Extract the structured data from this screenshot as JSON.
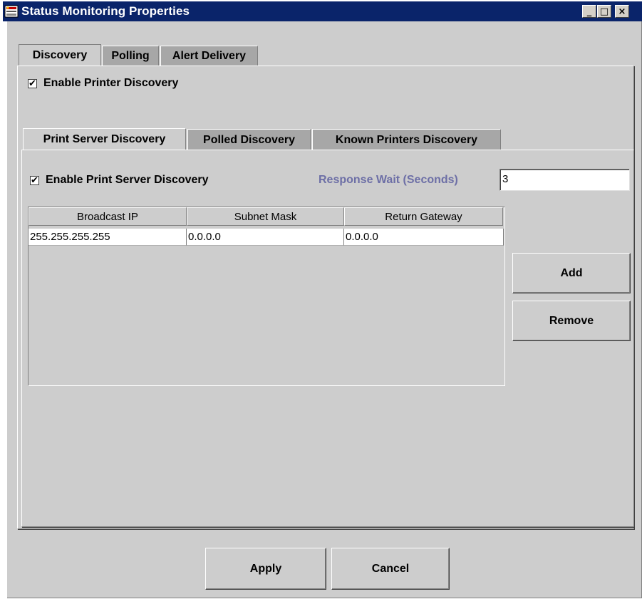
{
  "window": {
    "title": "Status Monitoring Properties",
    "minimize_glyph": "_",
    "maximize_glyph": "□",
    "close_glyph": "×"
  },
  "main_tabs": [
    {
      "label": "Discovery",
      "active": true
    },
    {
      "label": "Polling",
      "active": false
    },
    {
      "label": "Alert Delivery",
      "active": false
    }
  ],
  "enable_printer_discovery": {
    "label": "Enable Printer Discovery",
    "checked": true
  },
  "sub_tabs": [
    {
      "label": "Print Server Discovery",
      "active": true
    },
    {
      "label": "Polled Discovery",
      "active": false
    },
    {
      "label": "Known Printers Discovery",
      "active": false
    }
  ],
  "enable_print_server_discovery": {
    "label": "Enable Print Server Discovery",
    "checked": true
  },
  "response_wait": {
    "label": "Response Wait (Seconds)",
    "value": "3"
  },
  "table": {
    "columns": [
      "Broadcast IP",
      "Subnet Mask",
      "Return Gateway"
    ],
    "rows": [
      [
        "255.255.255.255",
        "0.0.0.0",
        "0.0.0.0"
      ]
    ]
  },
  "buttons": {
    "add": "Add",
    "remove": "Remove",
    "apply": "Apply",
    "cancel": "Cancel"
  },
  "check_glyph": "✔",
  "colors": {
    "titlebar": "#0a246a",
    "dialog_bg": "#cdcdcd",
    "inactive_tab": "#a7a7a7",
    "label_blue": "#6d6fa6"
  }
}
